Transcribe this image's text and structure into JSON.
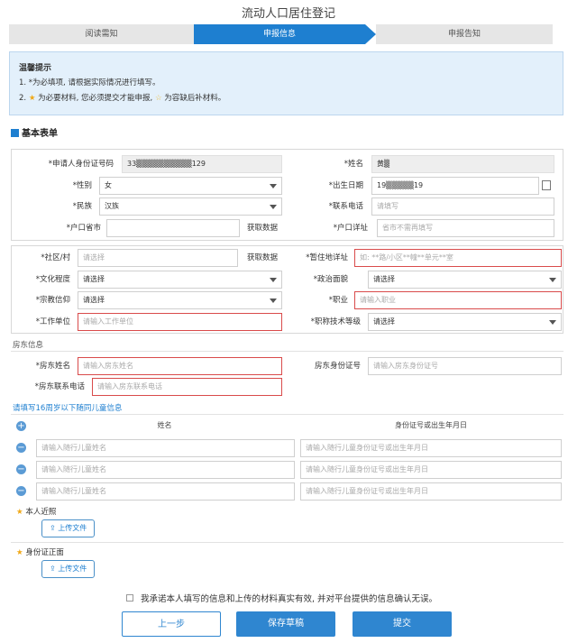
{
  "title": "流动人口居住登记",
  "steps": [
    "阅读需知",
    "申报信息",
    "申报告知"
  ],
  "tip": {
    "heading": "温馨提示",
    "line1": "1. *为必填项, 请根据实际情况进行填写。",
    "line2_prefix": "2.",
    "line2_a": "为必要材料, 您必须提交才能申报,",
    "line2_b": "为容缺后补材料。"
  },
  "section_basic": "基本表单",
  "basic": {
    "id_label": "*申请人身份证号码",
    "id_value": "33▒▒▒▒▒▒▒▒▒▒129",
    "name_label": "*姓名",
    "name_value": "黄▒",
    "gender_label": "*性别",
    "gender_value": "女",
    "birth_label": "*出生日期",
    "birth_value": "19▒▒▒▒▒19",
    "ethnic_label": "*民族",
    "ethnic_value": "汉族",
    "phone_label": "*联系电话",
    "phone_placeholder": "请填写",
    "hukou_label": "*户口省市",
    "hukou_fetch": "获取数据",
    "hukou_detail_label": "*户口详址",
    "hukou_detail_placeholder": "省市不需再填写"
  },
  "residence": {
    "community_label": "*社区/村",
    "community_placeholder": "请选择",
    "community_fetch": "获取数据",
    "addr_label": "*暂住地详址",
    "addr_placeholder": "如: **路/小区**幢**单元**室",
    "edu_label": "*文化程度",
    "edu_placeholder": "请选择",
    "political_label": "*政治面貌",
    "political_placeholder": "请选择",
    "religion_label": "*宗教信仰",
    "religion_placeholder": "请选择",
    "job_label": "*职业",
    "job_placeholder": "请输入职业",
    "work_label": "*工作单位",
    "work_placeholder": "请输入工作单位",
    "title_label": "*职称技术等级",
    "title_placeholder": "请选择"
  },
  "landlord": {
    "heading": "房东信息",
    "name_label": "*房东姓名",
    "name_placeholder": "请输入房东姓名",
    "id_label": "房东身份证号",
    "id_placeholder": "请输入房东身份证号",
    "phone_label": "*房东联系电话",
    "phone_placeholder": "请输入房东联系电话"
  },
  "children": {
    "heading": "请填写16周岁以下随同儿童信息",
    "col_name": "姓名",
    "col_id": "身份证号或出生年月日",
    "name_placeholder": "请输入随行儿童姓名",
    "id_placeholder": "请输入随行儿童身份证号或出生年月日"
  },
  "uploads": {
    "photo_label": "本人近照",
    "idcard_label": "身份证正面",
    "upload_text": "上传文件"
  },
  "agree_text": "我承诺本人填写的信息和上传的材料真实有效, 并对平台提供的信息确认无误。",
  "buttons": {
    "prev": "上一步",
    "save": "保存草稿",
    "submit": "提交"
  }
}
